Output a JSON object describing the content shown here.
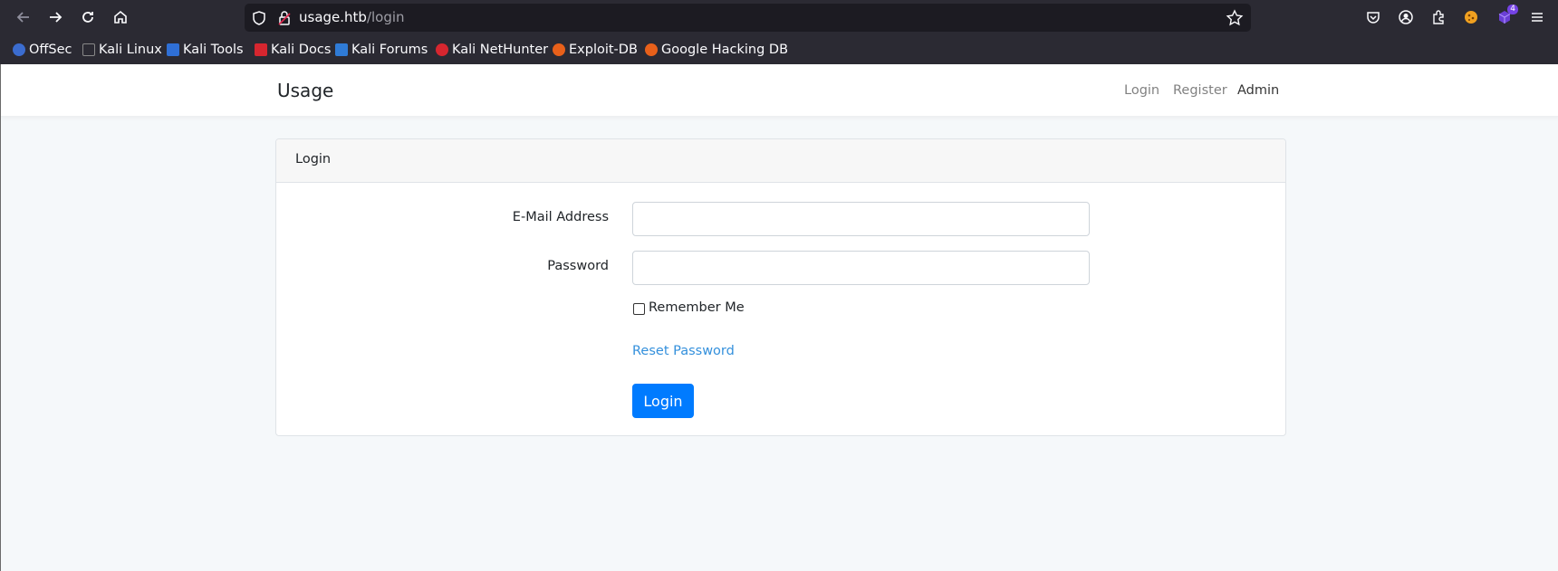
{
  "browser": {
    "url_host": "usage.htb",
    "url_path": "/login",
    "extension_badge": "4",
    "bookmarks": [
      {
        "label": "OffSec",
        "color": "#3b6ccf"
      },
      {
        "label": "Kali Linux",
        "color": "#2b2a33"
      },
      {
        "label": "Kali Tools",
        "color": "#2f6fd6"
      },
      {
        "label": "Kali Docs",
        "color": "#d6262f"
      },
      {
        "label": "Kali Forums",
        "color": "#2f7bd6"
      },
      {
        "label": "Kali NetHunter",
        "color": "#d6262f"
      },
      {
        "label": "Exploit-DB",
        "color": "#e8601a"
      },
      {
        "label": "Google Hacking DB",
        "color": "#e8601a"
      }
    ]
  },
  "navbar": {
    "brand": "Usage",
    "links": [
      {
        "label": "Login"
      },
      {
        "label": "Register"
      },
      {
        "label": "Admin"
      }
    ]
  },
  "card": {
    "header": "Login",
    "email_label": "E-Mail Address",
    "email_value": "",
    "password_label": "Password",
    "password_value": "",
    "remember_label": "Remember Me",
    "remember_checked": false,
    "reset_link": "Reset Password",
    "submit_label": "Login"
  },
  "colors": {
    "primary": "#007bff",
    "link": "#3490dc",
    "page_bg": "#f5f8fa"
  }
}
